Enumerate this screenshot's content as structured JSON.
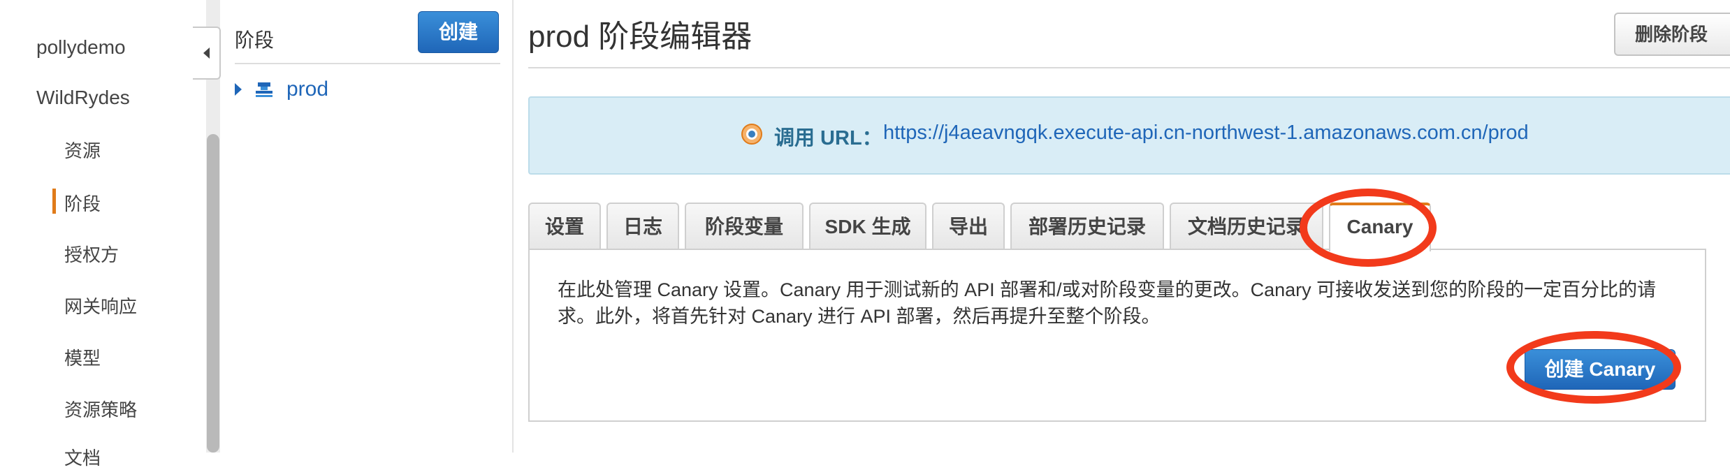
{
  "nav": {
    "apis": [
      "pollydemo",
      "WildRydes"
    ],
    "items": [
      {
        "label": "资源"
      },
      {
        "label": "阶段"
      },
      {
        "label": "授权方"
      },
      {
        "label": "网关响应"
      },
      {
        "label": "模型"
      },
      {
        "label": "资源策略"
      },
      {
        "label": "文档"
      }
    ],
    "active_item": "阶段"
  },
  "stage_panel": {
    "title": "阶段",
    "create_label": "创建",
    "stages": [
      {
        "name": "prod"
      }
    ]
  },
  "editor": {
    "title": "prod 阶段编辑器",
    "delete_label": "删除阶段",
    "invoke_label": "调用 URL：",
    "invoke_url": "https://j4aeavngqk.execute-api.cn-northwest-1.amazonaws.com.cn/prod",
    "tabs": [
      {
        "label": "设置"
      },
      {
        "label": "日志"
      },
      {
        "label": "阶段变量"
      },
      {
        "label": "SDK 生成"
      },
      {
        "label": "导出"
      },
      {
        "label": "部署历史记录"
      },
      {
        "label": "文档历史记录"
      },
      {
        "label": "Canary"
      }
    ],
    "active_tab": "Canary",
    "canary": {
      "description": "在此处管理 Canary 设置。Canary 用于测试新的 API 部署和/或对阶段变量的更改。Canary 可接收发送到您的阶段的一定百分比的请求。此外，将首先针对 Canary 进行 API 部署，然后再提升至整个阶段。",
      "create_label": "创建 Canary"
    }
  },
  "colors": {
    "accent_orange": "#e07b1a",
    "primary_blue": "#1f66b8",
    "info_bg": "#d9edf6",
    "annotation_red": "#f23a1b"
  },
  "icons": {
    "stage": "stage-icon",
    "invoke": "radio-target-icon",
    "collapse": "chevron-left-icon"
  }
}
